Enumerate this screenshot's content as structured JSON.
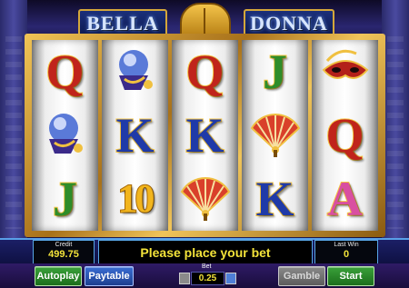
{
  "title": {
    "left": "BELLA",
    "right": "DONNA"
  },
  "reels": [
    [
      {
        "kind": "letter",
        "text": "Q",
        "color": "red",
        "icon": "letter-q-symbol"
      },
      {
        "kind": "image",
        "icon": "crystal-ball-symbol"
      },
      {
        "kind": "letter",
        "text": "J",
        "color": "green",
        "icon": "letter-j-symbol"
      }
    ],
    [
      {
        "kind": "image",
        "icon": "crystal-ball-symbol"
      },
      {
        "kind": "letter",
        "text": "K",
        "color": "blue",
        "icon": "letter-k-symbol"
      },
      {
        "kind": "letter",
        "text": "10",
        "color": "gold",
        "icon": "number-10-symbol"
      }
    ],
    [
      {
        "kind": "letter",
        "text": "Q",
        "color": "red",
        "icon": "letter-q-symbol"
      },
      {
        "kind": "letter",
        "text": "K",
        "color": "blue",
        "icon": "letter-k-symbol"
      },
      {
        "kind": "image",
        "icon": "hand-fan-symbol"
      }
    ],
    [
      {
        "kind": "letter",
        "text": "J",
        "color": "green",
        "icon": "letter-j-symbol"
      },
      {
        "kind": "image",
        "icon": "hand-fan-symbol"
      },
      {
        "kind": "letter",
        "text": "K",
        "color": "blue",
        "icon": "letter-k-symbol"
      }
    ],
    [
      {
        "kind": "image",
        "icon": "carnival-mask-symbol"
      },
      {
        "kind": "letter",
        "text": "Q",
        "color": "red",
        "icon": "letter-q-symbol"
      },
      {
        "kind": "letter",
        "text": "A",
        "color": "pink",
        "icon": "letter-a-symbol"
      }
    ]
  ],
  "status": {
    "credit_label": "Credit",
    "credit_value": "499.75",
    "message": "Please place your bet",
    "last_win_label": "Last Win",
    "last_win_value": "0"
  },
  "controls": {
    "autoplay_label": "Autoplay",
    "paytable_label": "Paytable",
    "bet_label": "Bet",
    "bet_value": "0.25",
    "gamble_label": "Gamble",
    "start_label": "Start"
  },
  "colors": {
    "letter_red": "#c0241b",
    "letter_blue": "#1f3aa8",
    "letter_green": "#2e8d2a",
    "letter_pink": "#d94fa1",
    "letter_gold": "#f2b51d",
    "status_text": "#f3e33a",
    "button_green": "#2b8a2b",
    "button_blue": "#2f58b8"
  }
}
